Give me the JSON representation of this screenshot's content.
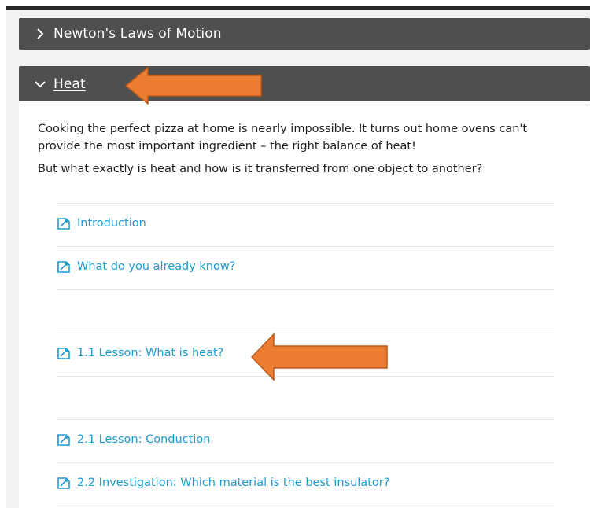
{
  "sections": [
    {
      "title": "Newton's Laws of Motion",
      "icon": "chevron-right-icon",
      "expanded": false
    },
    {
      "title": "Heat",
      "icon": "chevron-down-icon",
      "expanded": true
    }
  ],
  "heat": {
    "paragraph1": "Cooking the perfect pizza at home is nearly impossible. It turns out home ovens can't provide the most important ingredient – the right balance of heat!",
    "paragraph2": "But what exactly is heat and how is it transferred from one object to another?",
    "activities": [
      {
        "label": "Introduction",
        "icon": "activity-icon"
      },
      {
        "label": "What do you already know?",
        "icon": "activity-icon"
      },
      {
        "label": "",
        "icon": ""
      },
      {
        "label": "1.1 Lesson: What is heat?",
        "icon": "activity-icon"
      },
      {
        "label": "",
        "icon": ""
      },
      {
        "label": "2.1 Lesson: Conduction",
        "icon": "activity-icon"
      },
      {
        "label": "2.2 Investigation: Which material is the best insulator?",
        "icon": "activity-icon"
      }
    ]
  },
  "colors": {
    "header_bg": "#4f4f4f",
    "link": "#1a9ccf",
    "annotation_arrow": "#ed7d31"
  }
}
